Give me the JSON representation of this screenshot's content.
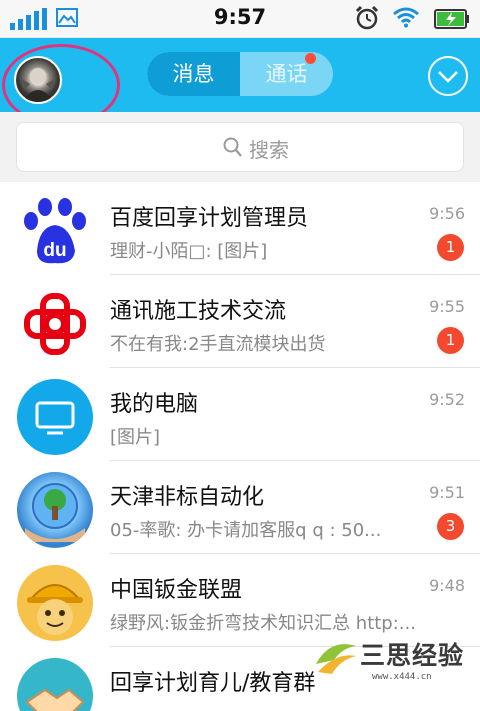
{
  "status_bar": {
    "time": "9:57",
    "icons": [
      "signal-icon",
      "image-icon",
      "alarm-icon",
      "wifi-icon",
      "battery-charging-icon"
    ]
  },
  "header": {
    "tabs": [
      {
        "label": "消息",
        "selected": true
      },
      {
        "label": "通话",
        "selected": false,
        "has_dot": true
      }
    ],
    "colors": {
      "bar": "#1ebbf0",
      "selected_tab": "#0f9dd6",
      "dot": "#ff4c3a",
      "highlight_ring": "#e0347f"
    }
  },
  "search": {
    "placeholder": "搜索"
  },
  "conversations": [
    {
      "title": "百度回享计划管理员",
      "snippet": "理财-小陌□: [图片]",
      "time": "9:56",
      "unread": "1",
      "avatar": "baidu-logo"
    },
    {
      "title": "通讯施工技术交流",
      "snippet": "不在有我:2手直流模块出货",
      "time": "9:55",
      "unread": "1",
      "avatar": "china-unicom-knot"
    },
    {
      "title": "我的电脑",
      "snippet": "[图片]",
      "time": "9:52",
      "unread": "",
      "avatar": "monitor-icon"
    },
    {
      "title": "天津非标自动化",
      "snippet": "05-率歌: 办卡请加客服q q : 50...",
      "time": "9:51",
      "unread": "3",
      "avatar": "globe-tree"
    },
    {
      "title": "中国钣金联盟",
      "snippet": "绿野风:钣金折弯技术知识汇总 http:...",
      "time": "9:48",
      "unread": "",
      "avatar": "worker-cartoon"
    },
    {
      "title": "回享计划育儿/教育群",
      "snippet": "",
      "time": "",
      "unread": "",
      "avatar": "handshake"
    }
  ],
  "watermark": {
    "brand": "三思经验",
    "url": "www.x444.cn"
  },
  "badge_color": "#f2492f"
}
